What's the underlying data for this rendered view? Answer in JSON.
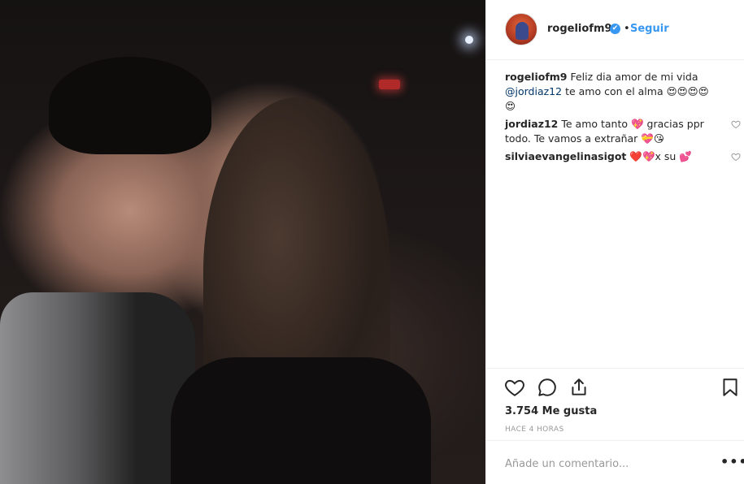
{
  "post": {
    "username": "rogeliofm9",
    "verified_mark": "✔",
    "separator": "•",
    "follow_label": "Seguir",
    "caption": {
      "user": "rogeliofm9",
      "text_1": "Feliz dia amor de mi vida",
      "mention": "@jordiaz12",
      "text_2": "te amo con el alma 😍😍😍😍😍"
    },
    "comments": [
      {
        "user": "jordiaz12",
        "text": "Te amo tanto 💖 gracias ppr todo. Te vamos a extrañar 💝😘"
      },
      {
        "user": "silviaevangelinasigot",
        "text": "❤️💖x su 💕"
      }
    ],
    "likes": "3.754 Me gusta",
    "time": "HACE 4 HORAS",
    "comment_placeholder": "Añade un comentario...",
    "more_label": "•••"
  },
  "icons": [
    "heart-icon",
    "comment-icon",
    "share-icon",
    "bookmark-icon",
    "small-heart-icon",
    "verified-badge-icon",
    "avatar"
  ]
}
